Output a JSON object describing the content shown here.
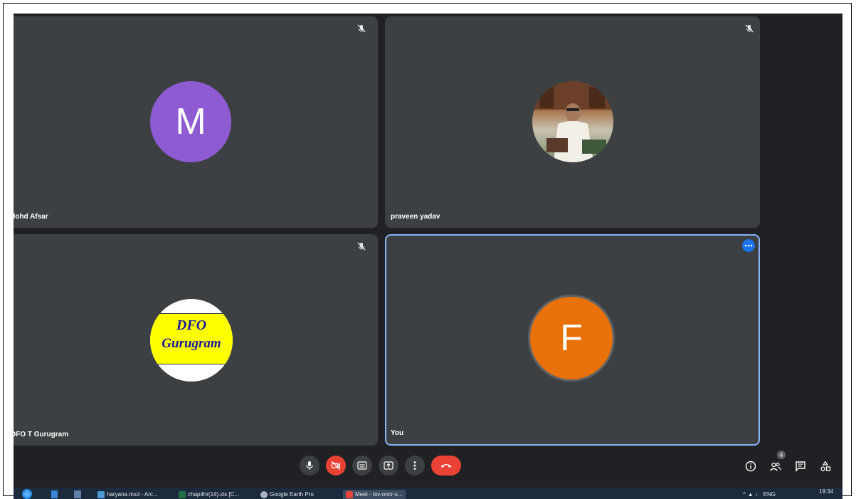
{
  "participants": [
    {
      "name": "Mohd Afsar",
      "initial": "M",
      "avatar_color": "#8e5bd2",
      "muted": true
    },
    {
      "name": "praveen yadav",
      "muted": true
    },
    {
      "name": "DFO T Gurugram",
      "logo_line1": "DFO",
      "logo_line2": "Gurugram",
      "muted": true
    },
    {
      "name": "You",
      "initial": "F",
      "avatar_color": "#e8710a"
    }
  ],
  "participant_count": "4",
  "colors": {
    "background": "#202124",
    "tile": "#3c4043",
    "end_call": "#ea4335",
    "camera_off": "#ea4335",
    "active_border": "#8ab4f8",
    "more_button": "#1a73e8"
  },
  "controls": [
    "mic-icon",
    "camera-off-icon",
    "captions-icon",
    "present-icon",
    "more-options-icon",
    "end-call-icon"
  ],
  "side_controls": [
    "info-icon",
    "people-icon",
    "chat-icon",
    "activities-icon"
  ],
  "taskbar": {
    "items": [
      "haryana.mxd - Arc...",
      "chap4hr(14).xls [C...",
      "Google Earth Pro",
      "Meet - tsv-oncr-s..."
    ],
    "language": "ENG",
    "time": "19:34"
  }
}
